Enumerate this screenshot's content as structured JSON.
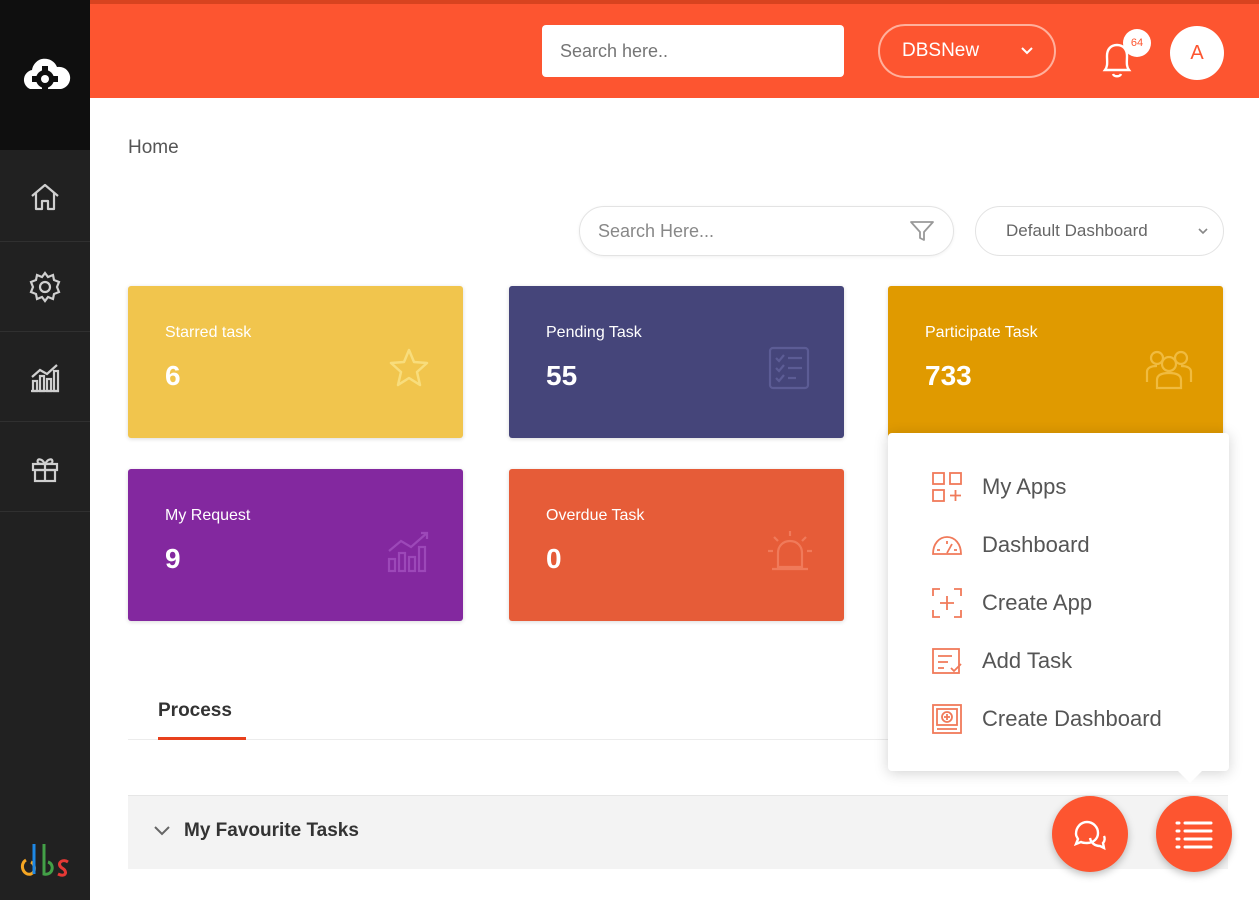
{
  "colors": {
    "accent": "#fd5530",
    "sidebar": "#212121",
    "card_starred": "#f1c54d",
    "card_pending": "#45457a",
    "card_participate": "#e09a00",
    "card_request": "#83289f",
    "card_overdue": "#e65c38"
  },
  "header": {
    "search_placeholder": "Search here..",
    "workspace": "DBSNew",
    "notification_count": "64",
    "avatar_initial": "A"
  },
  "sidebar": {
    "items": [
      {
        "icon": "home-icon"
      },
      {
        "icon": "gear-icon"
      },
      {
        "icon": "chart-icon"
      },
      {
        "icon": "gift-icon"
      }
    ],
    "brand": "dbs"
  },
  "breadcrumb": "Home",
  "toolbar": {
    "search_placeholder": "Search Here...",
    "dashboard_select": "Default Dashboard"
  },
  "cards": [
    {
      "title": "Starred task",
      "value": "6",
      "icon": "star-icon"
    },
    {
      "title": "Pending Task",
      "value": "55",
      "icon": "checklist-icon"
    },
    {
      "title": "Participate Task",
      "value": "733",
      "icon": "people-icon"
    },
    {
      "title": "My Request",
      "value": "9",
      "icon": "growth-chart-icon"
    },
    {
      "title": "Overdue Task",
      "value": "0",
      "icon": "alarm-icon"
    }
  ],
  "tabs": [
    {
      "label": "Process"
    }
  ],
  "favourites": {
    "title": "My Favourite Tasks"
  },
  "menu": {
    "items": [
      {
        "label": "My Apps",
        "icon": "apps-grid-icon"
      },
      {
        "label": "Dashboard",
        "icon": "speedometer-icon"
      },
      {
        "label": "Create App",
        "icon": "create-app-icon"
      },
      {
        "label": "Add Task",
        "icon": "add-task-icon"
      },
      {
        "label": "Create Dashboard",
        "icon": "create-dashboard-icon"
      }
    ]
  }
}
